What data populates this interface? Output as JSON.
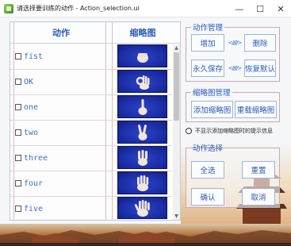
{
  "window": {
    "title": "请选择要训练的动作 - Action_selection.ui",
    "minimize": "—",
    "maximize": "☐",
    "close": "✕"
  },
  "table": {
    "headers": [
      "动作",
      "缩略图"
    ],
    "rows": [
      {
        "label": "fist",
        "checked": false
      },
      {
        "label": "OK",
        "checked": false
      },
      {
        "label": "one",
        "checked": false
      },
      {
        "label": "two",
        "checked": false
      },
      {
        "label": "three",
        "checked": false
      },
      {
        "label": "four",
        "checked": false
      },
      {
        "label": "five",
        "checked": false
      }
    ]
  },
  "action_manage": {
    "title": "动作管理",
    "add": "增加",
    "delete": "删除",
    "save": "永久保存",
    "restore": "恢复默认"
  },
  "thumb_manage": {
    "title": "缩略图管理",
    "add_thumb": "添加缩略图",
    "reload_thumb": "重载缩略图"
  },
  "option": {
    "no_prompt": "不显示添加缩略图时的提示信息",
    "selected": false
  },
  "action_select": {
    "title": "动作选择",
    "select_all": "全选",
    "reset": "重置",
    "ok": "确认",
    "cancel": "取消"
  },
  "colors": {
    "accent": "#2a5cb8",
    "thumb_bg": "#1c2ea8"
  }
}
